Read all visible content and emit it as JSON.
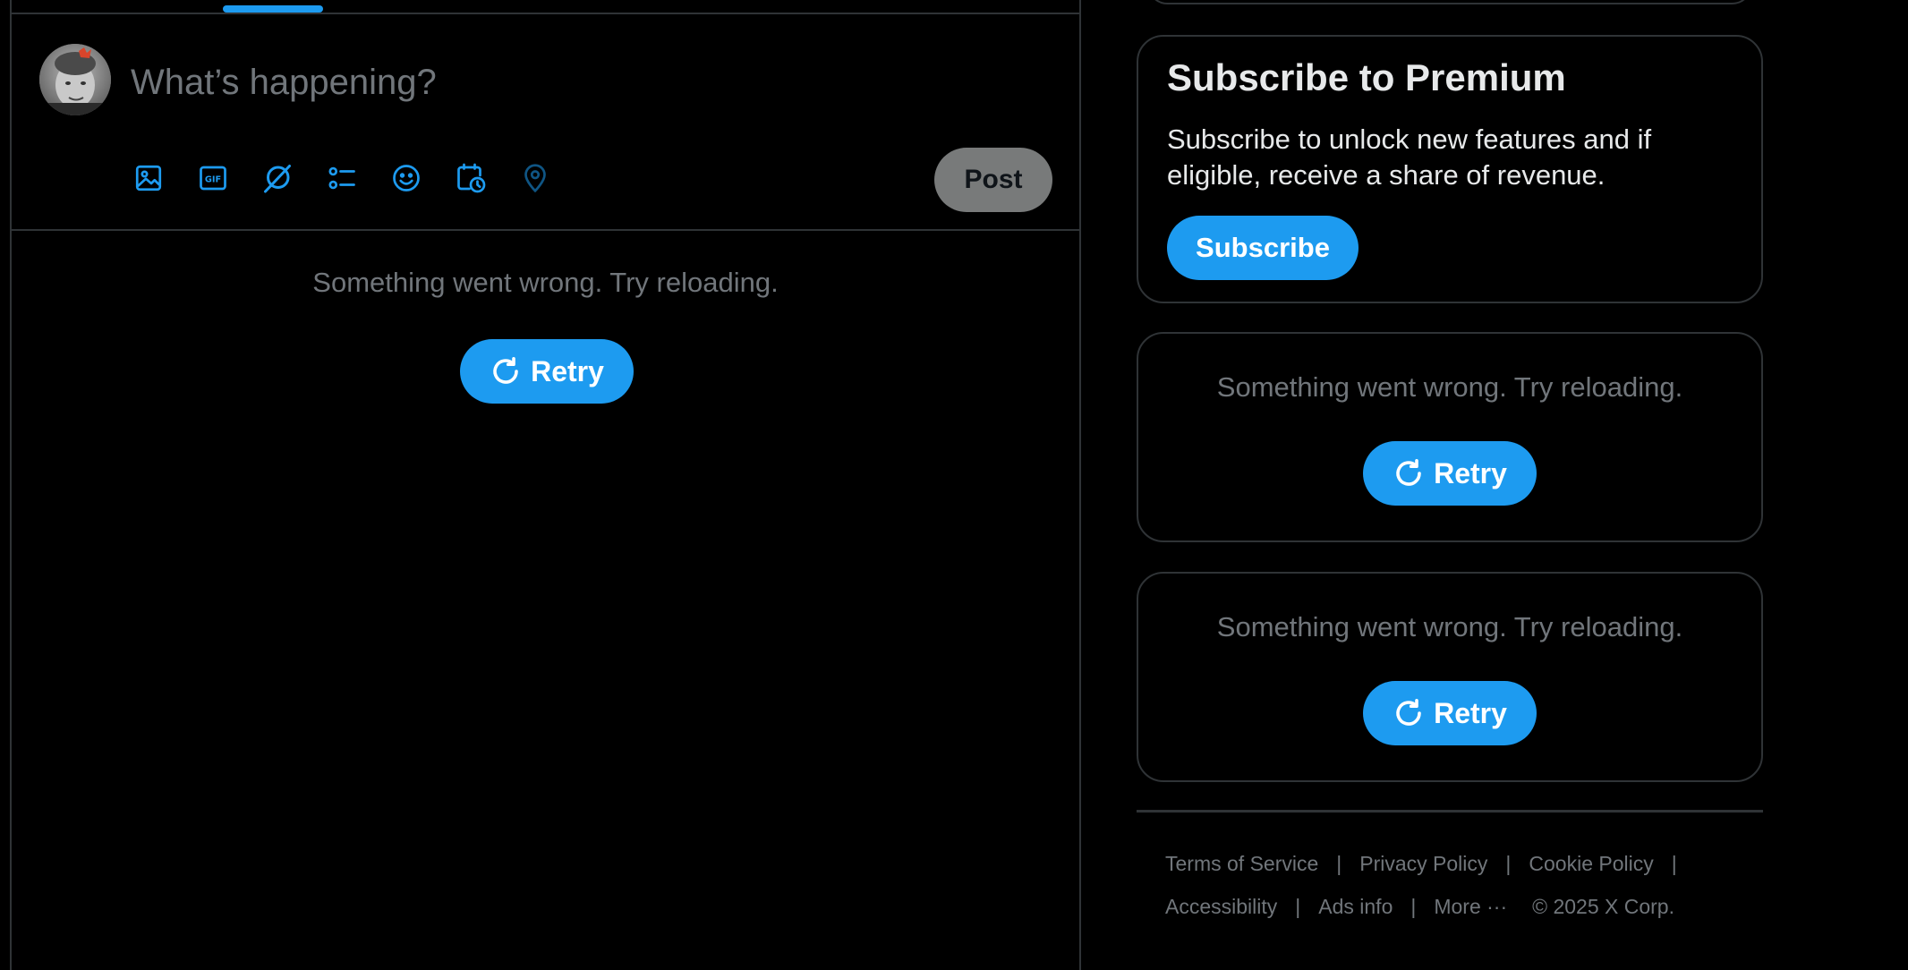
{
  "composer": {
    "placeholder": "What’s happening?",
    "post_label": "Post",
    "tools": [
      {
        "name": "media-icon",
        "label": "Media"
      },
      {
        "name": "gif-icon",
        "label": "GIF"
      },
      {
        "name": "grok-icon",
        "label": "Grok"
      },
      {
        "name": "poll-icon",
        "label": "Poll"
      },
      {
        "name": "emoji-icon",
        "label": "Emoji"
      },
      {
        "name": "schedule-icon",
        "label": "Schedule"
      },
      {
        "name": "location-icon",
        "label": "Location"
      }
    ]
  },
  "main": {
    "error_message": "Something went wrong. Try reloading.",
    "retry_label": "Retry"
  },
  "sidebar": {
    "premium": {
      "title": "Subscribe to Premium",
      "description": "Subscribe to unlock new features and if eligible, receive a share of revenue.",
      "button_label": "Subscribe"
    },
    "error_cards": [
      {
        "message": "Something went wrong. Try reloading.",
        "retry_label": "Retry"
      },
      {
        "message": "Something went wrong. Try reloading.",
        "retry_label": "Retry"
      }
    ]
  },
  "footer": {
    "links": {
      "terms": "Terms of Service",
      "privacy": "Privacy Policy",
      "cookie": "Cookie Policy",
      "accessibility": "Accessibility",
      "ads": "Ads info",
      "more": "More ···"
    },
    "separator": "|",
    "copyright": "© 2025 X Corp."
  },
  "colors": {
    "accent": "#1d9bf0",
    "background": "#000000",
    "border": "#2f3336",
    "muted_text": "#71767b",
    "post_button_disabled": "#787a7a"
  }
}
